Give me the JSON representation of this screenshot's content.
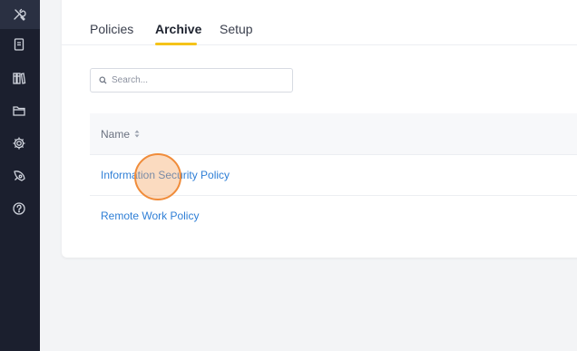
{
  "tabs": [
    {
      "label": "Policies"
    },
    {
      "label": "Archive"
    },
    {
      "label": "Setup"
    }
  ],
  "active_tab": "Archive",
  "search": {
    "placeholder": "Search...",
    "value": ""
  },
  "table": {
    "columns": [
      {
        "label": "Name",
        "sortable": true
      }
    ],
    "rows": [
      {
        "name": "Information Security Policy"
      },
      {
        "name": "Remote Work Policy"
      }
    ]
  },
  "sidebar": {
    "icons": [
      "tools-icon",
      "document-icon",
      "library-icon",
      "folder-icon",
      "settings-icon",
      "rocket-icon",
      "help-icon"
    ]
  },
  "colors": {
    "sidebar_bg": "#1b1f2e",
    "accent": "#f5c318",
    "link": "#2f7fd6",
    "cursor": "#f08c3a"
  }
}
